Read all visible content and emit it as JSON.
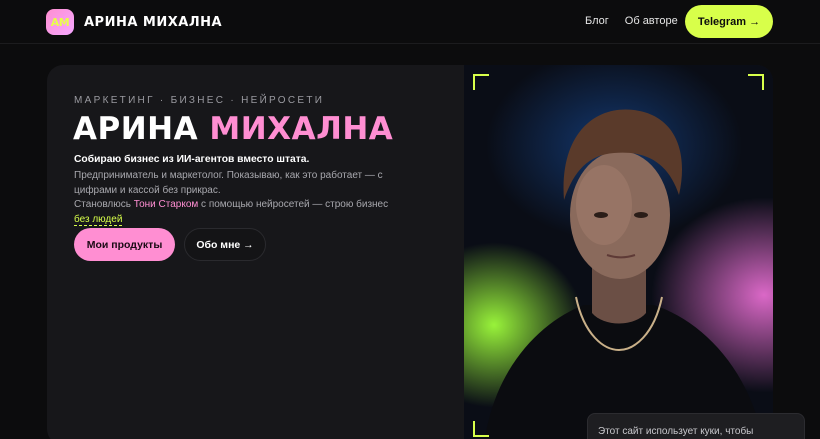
{
  "header": {
    "logo_badge": "АМ",
    "logo_text": "АРИНА МИХАЛНА",
    "nav": [
      "Блог",
      "Об авторе"
    ],
    "telegram_label": "Telegram →"
  },
  "hero": {
    "tags": "МАРКЕТИНГ · БИЗНЕС · НЕЙРОСЕТИ",
    "title_part1": "АРИНА ",
    "title_part2": "МИХАЛНА",
    "lead": "Собираю бизнес из ИИ-агентов вместо штата.",
    "desc_line1": "Предприниматель и маркетолог. Показываю, как это работает — с цифрами и кассой без прикрас.",
    "desc_line2_pre": "Становлюсь ",
    "desc_line2_pink": "Тони Старком",
    "desc_line2_mid": " с помощью нейросетей — строю бизнес ",
    "desc_line2_lime": "без людей",
    "primary_button": "Мои продукты",
    "secondary_button": "Обо мне →"
  },
  "cookie": {
    "text": "Этот сайт использует куки, чтобы"
  },
  "colors": {
    "accent_lime": "#d8ff4a",
    "accent_pink": "#ff8ed2",
    "background": "#0c0c0d"
  }
}
